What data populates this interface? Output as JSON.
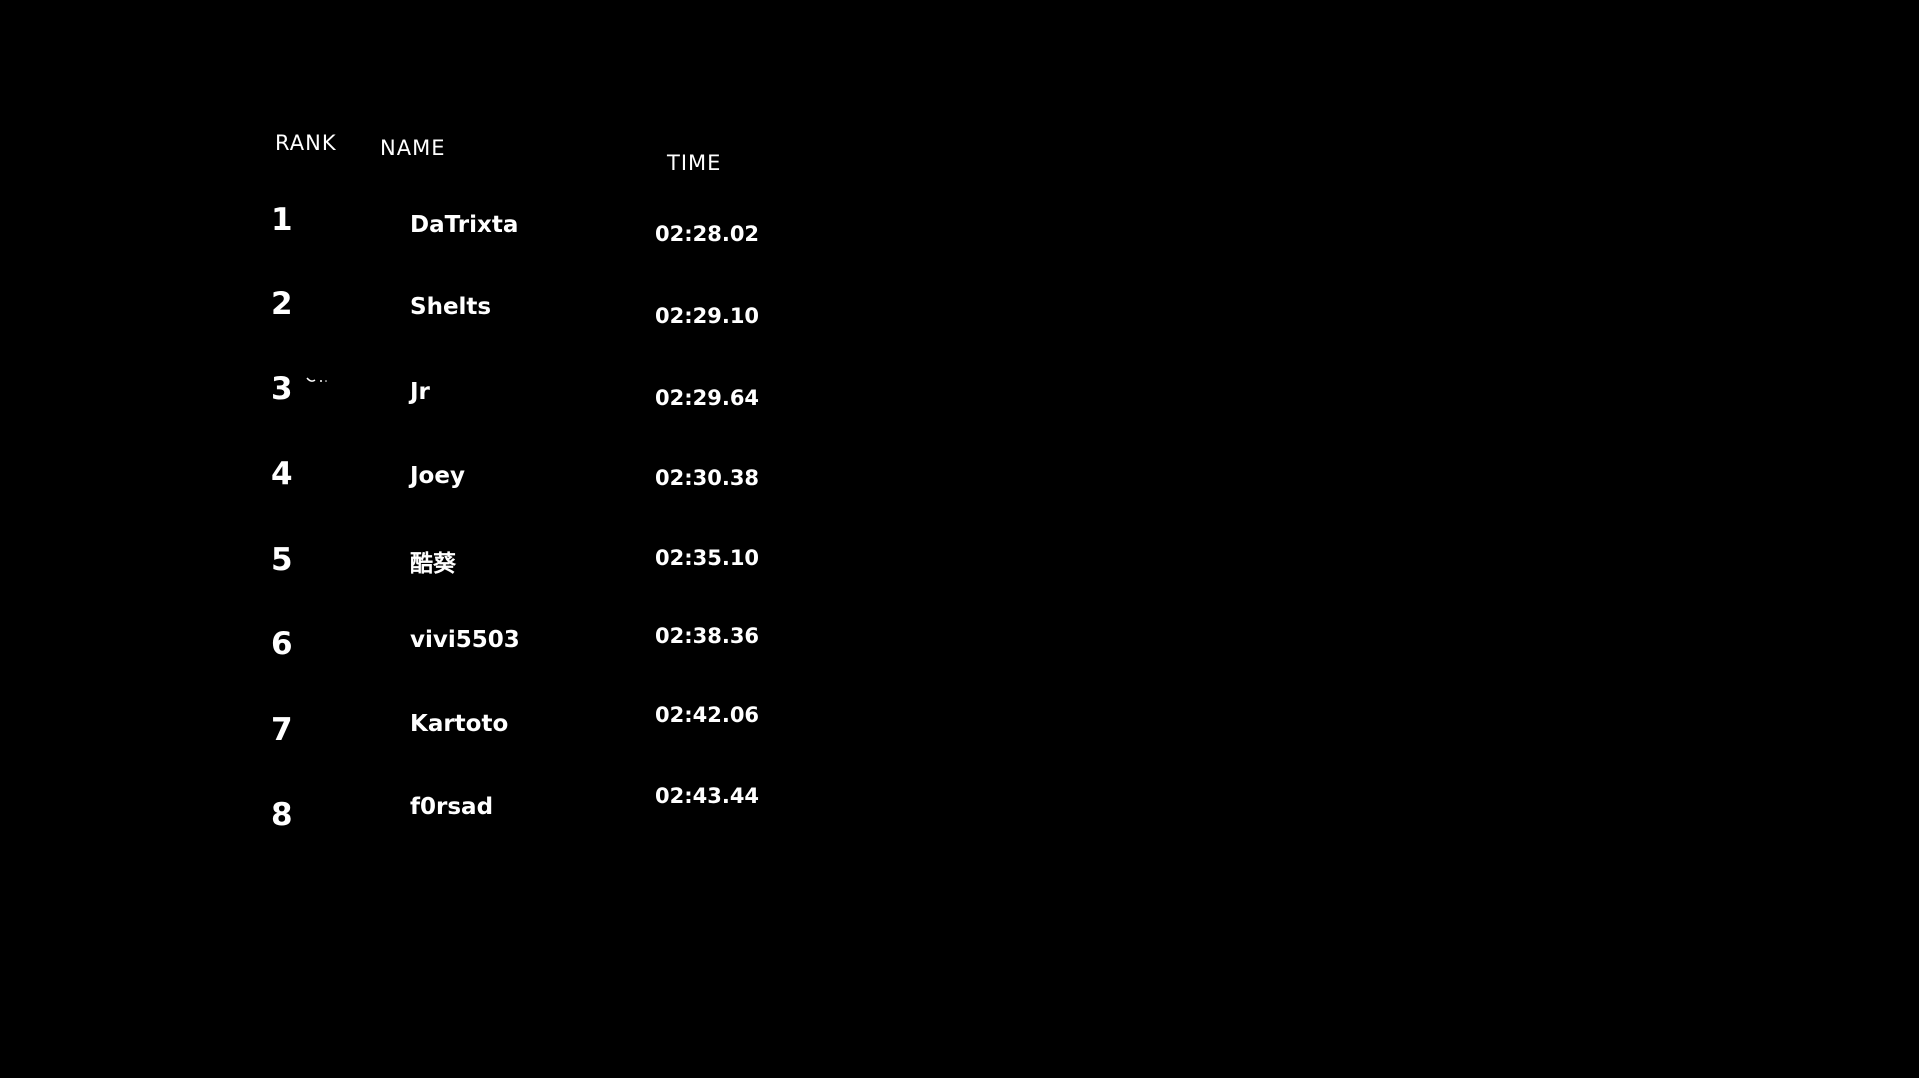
{
  "leaderboard": {
    "headers": {
      "rank": "RANK",
      "name": "NAME",
      "time": "TIME"
    },
    "rows": [
      {
        "rank": "1",
        "name": "DaTrixta",
        "time": "02:28.02"
      },
      {
        "rank": "2",
        "name": "Shelts",
        "time": "02:29.10"
      },
      {
        "rank": "3",
        "name": "Jr",
        "time": "02:29.64"
      },
      {
        "rank": "4",
        "name": "Joey",
        "time": "02:30.38"
      },
      {
        "rank": "5",
        "name": "酷葵",
        "time": "02:35.10"
      },
      {
        "rank": "6",
        "name": "vivi5503",
        "time": "02:38.36"
      },
      {
        "rank": "7",
        "name": "Kartoto",
        "time": "02:42.06"
      },
      {
        "rank": "8",
        "name": "f0rsad",
        "time": "02:43.44"
      }
    ]
  },
  "colors": {
    "background": "#000000",
    "text": "#ffffff"
  }
}
